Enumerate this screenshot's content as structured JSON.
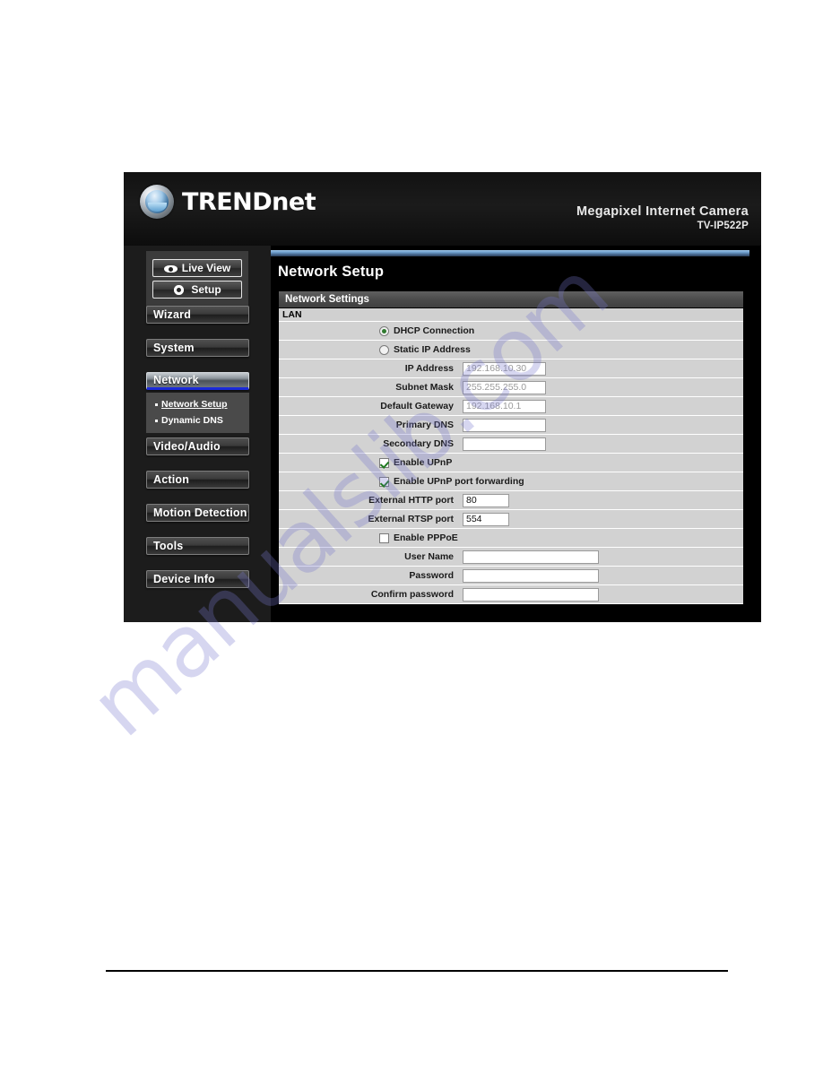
{
  "watermark": {
    "text": "manualslib.com"
  },
  "banner": {
    "logo_text": "TRENDnet",
    "product_name": "Megapixel Internet Camera",
    "product_model": "TV-IP522P"
  },
  "sidebar": {
    "top_buttons": [
      {
        "label": "Live View",
        "icon": "eye-icon"
      },
      {
        "label": "Setup",
        "icon": "gear-icon"
      }
    ],
    "nav_items": [
      {
        "label": "Wizard",
        "active": false
      },
      {
        "label": "System",
        "active": false
      },
      {
        "label": "Network",
        "active": true
      },
      {
        "label": "Video/Audio",
        "active": false
      },
      {
        "label": "Action",
        "active": false
      },
      {
        "label": "Motion Detection",
        "active": false
      },
      {
        "label": "Tools",
        "active": false
      },
      {
        "label": "Device Info",
        "active": false
      }
    ],
    "submenu": [
      {
        "label": "Network Setup",
        "selected": true
      },
      {
        "label": "Dynamic DNS",
        "selected": false
      }
    ]
  },
  "content": {
    "page_title": "Network Setup",
    "section_title": "Network Settings",
    "group_label": "LAN",
    "rows": {
      "dhcp_connection": {
        "label": "DHCP Connection",
        "checked": true
      },
      "static_ip": {
        "label": "Static IP Address",
        "checked": false
      },
      "ip_address": {
        "label": "IP Address",
        "value": "192.168.10.30"
      },
      "subnet_mask": {
        "label": "Subnet Mask",
        "value": "255.255.255.0"
      },
      "default_gateway": {
        "label": "Default Gateway",
        "value": "192.168.10.1"
      },
      "primary_dns": {
        "label": "Primary DNS",
        "value": ""
      },
      "secondary_dns": {
        "label": "Secondary DNS",
        "value": ""
      },
      "enable_upnp": {
        "label": "Enable UPnP",
        "checked": true
      },
      "enable_upnp_forwarding": {
        "label": "Enable UPnP port forwarding",
        "checked": true
      },
      "external_http_port": {
        "label": "External HTTP port",
        "value": "80"
      },
      "external_rtsp_port": {
        "label": "External RTSP port",
        "value": "554"
      },
      "enable_pppoe": {
        "label": "Enable PPPoE",
        "checked": false
      },
      "user_name": {
        "label": "User Name",
        "value": ""
      },
      "password": {
        "label": "Password",
        "value": ""
      },
      "confirm_password": {
        "label": "Confirm password",
        "value": ""
      }
    }
  },
  "colors": {
    "accent_blue": "#1b2ad8",
    "panel_dark": "#0a0a0a",
    "row_gray": "#d2d2d2",
    "check_green": "#1f7a1f"
  }
}
